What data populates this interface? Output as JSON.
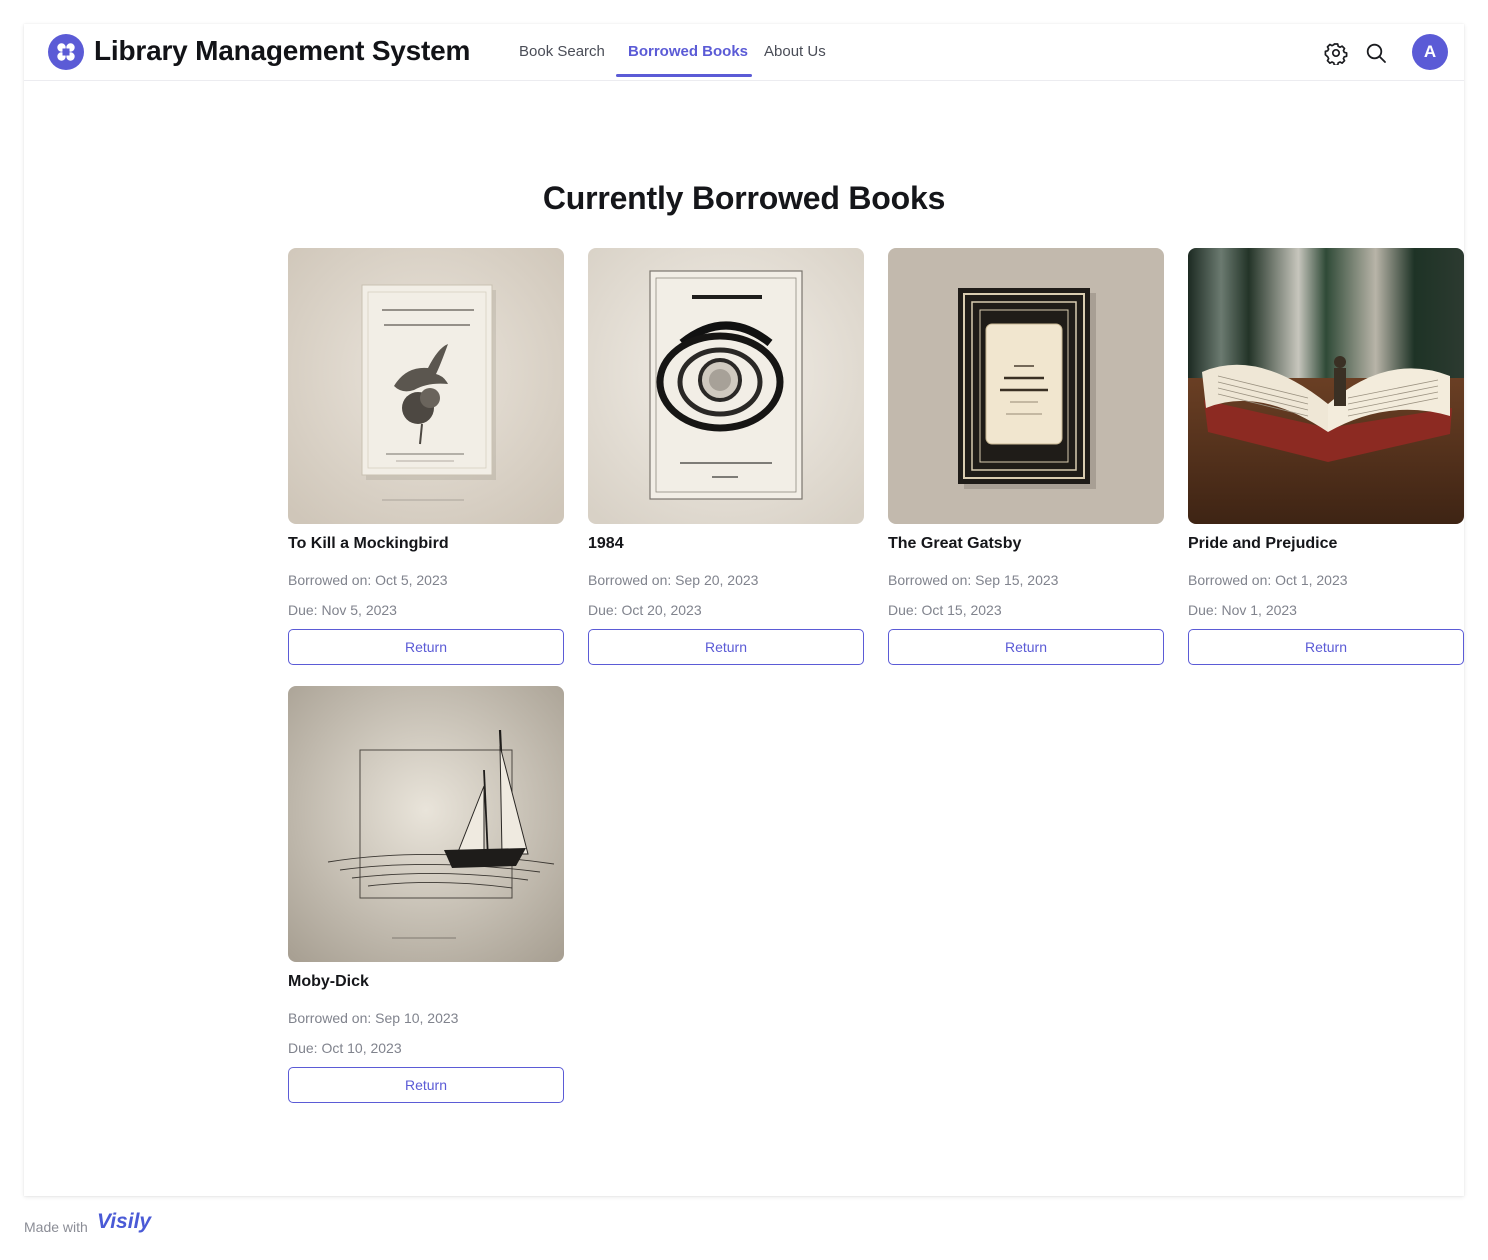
{
  "app": {
    "title": "Library Management System",
    "accent_color": "#5b5bd6",
    "logo_icon": "app-logo-icon"
  },
  "nav": {
    "tabs": [
      {
        "label": "Book Search",
        "active": false
      },
      {
        "label": "Borrowed Books",
        "active": true
      },
      {
        "label": "About Us",
        "active": false
      }
    ]
  },
  "header_actions": {
    "settings_icon": "gear-icon",
    "search_icon": "search-icon",
    "avatar_initial": "A"
  },
  "main": {
    "title": "Currently Borrowed Books",
    "books": [
      {
        "title": "To Kill a Mockingbird",
        "borrowed": "Borrowed on: Oct 5, 2023",
        "due": "Due: Nov 5, 2023",
        "action": "Return",
        "cover": "mockingbird-cover-image"
      },
      {
        "title": "1984",
        "borrowed": "Borrowed on: Sep 20, 2023",
        "due": "Due: Oct 20, 2023",
        "action": "Return",
        "cover": "1984-cover-image"
      },
      {
        "title": "The Great Gatsby",
        "borrowed": "Borrowed on: Sep 15, 2023",
        "due": "Due: Oct 15, 2023",
        "action": "Return",
        "cover": "gatsby-cover-image"
      },
      {
        "title": "Pride and Prejudice",
        "borrowed": "Borrowed on: Oct 1, 2023",
        "due": "Due: Nov 1, 2023",
        "action": "Return",
        "cover": "open-book-image"
      },
      {
        "title": "Moby-Dick",
        "borrowed": "Borrowed on: Sep 10, 2023",
        "due": "Due: Oct 10, 2023",
        "action": "Return",
        "cover": "sailing-ship-image"
      }
    ]
  },
  "footer": {
    "made_with": "Made with",
    "brand": "Visily"
  }
}
